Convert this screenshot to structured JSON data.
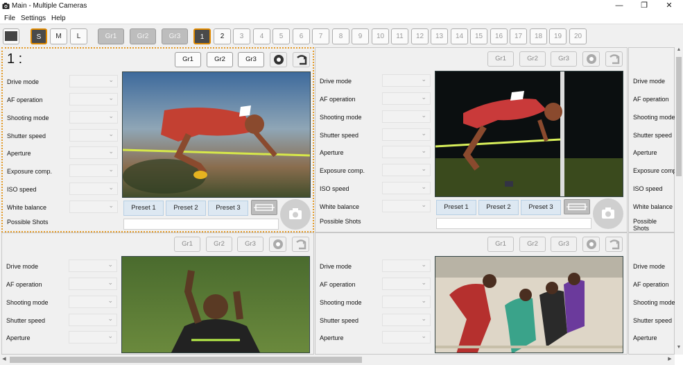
{
  "window": {
    "title": "Main - Multiple Cameras",
    "minimize": "—",
    "maximize": "❐",
    "close": "✕"
  },
  "menu": [
    "File",
    "Settings",
    "Help"
  ],
  "toolbar": {
    "sizes": [
      "S",
      "M",
      "L"
    ],
    "groups": [
      "Gr1",
      "Gr2",
      "Gr3"
    ],
    "numbers": [
      "1",
      "2",
      "3",
      "4",
      "5",
      "6",
      "7",
      "8",
      "9",
      "10",
      "11",
      "12",
      "13",
      "14",
      "15",
      "16",
      "17",
      "18",
      "19",
      "20"
    ]
  },
  "panel_labels": [
    "Drive mode",
    "AF operation",
    "Shooting mode",
    "Shutter speed",
    "Aperture",
    "Exposure comp.",
    "ISO speed",
    "White balance",
    "Possible Shots"
  ],
  "panel_groups": [
    "Gr1",
    "Gr2",
    "Gr3"
  ],
  "presets": [
    "Preset 1",
    "Preset 2",
    "Preset 3"
  ],
  "panel1_index": "1 :",
  "colors": {
    "active_border": "#e49a26",
    "preset_bg": "#dde8f2",
    "selected_btn": "#4a4a4a"
  }
}
